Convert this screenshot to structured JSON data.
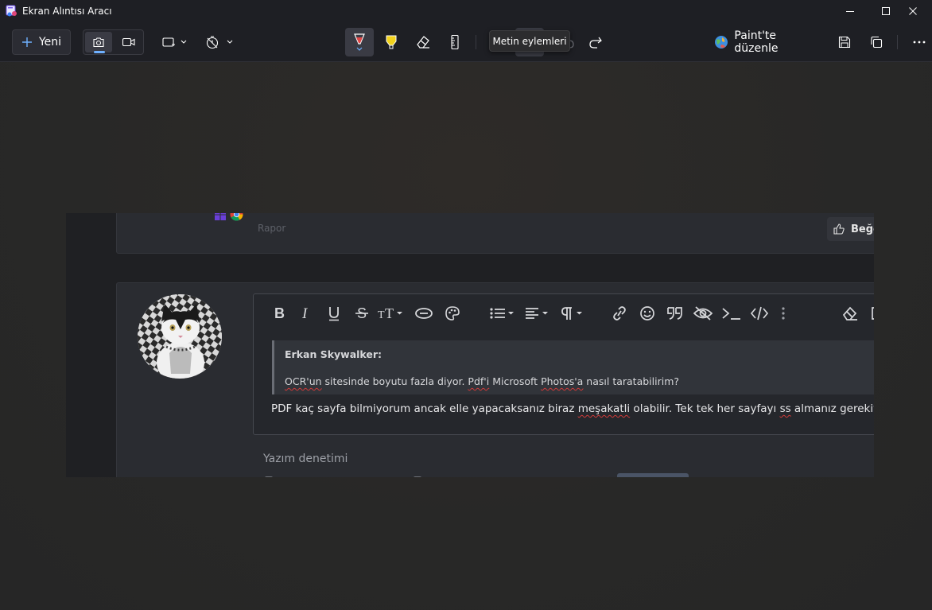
{
  "window": {
    "title": "Ekran Alıntısı Aracı"
  },
  "toolbar": {
    "new_label": "Yeni",
    "paint_label": "Paint'te düzenle",
    "tooltip": "Metin eylemleri"
  },
  "capture": {
    "post1": {
      "report_label": "Rapor",
      "like_label": "Beğe"
    },
    "editor": {
      "quote_author": "Erkan Skywalker:",
      "quote_text_parts": [
        "OCR'un",
        " sitesinde boyutu fazla diyor. ",
        "Pdf'i",
        " Microsoft ",
        "Photos'a",
        " nasıl taratabilirim?"
      ],
      "body_parts": [
        "PDF kaç sayfa bilmiyorum ancak elle yapacaksanız biraz ",
        "meşakatli",
        " olabilir. Tek tek her sayfayı ",
        "ss",
        " almanız gerekiyor önce, d"
      ]
    },
    "spellcheck_label": "Yazım denetimi"
  },
  "colors": {
    "accent": "#6fb1ff",
    "titlebar_bg": "#1e1f24",
    "canvas_bg": "#282827",
    "highlighter_yellow": "#f2d21c",
    "pen_red": "#e04848"
  },
  "icons": {
    "titlebar": [
      "snipping-tool-app-icon",
      "minimize-icon",
      "maximize-icon",
      "close-icon"
    ],
    "toolbar": [
      "plus-icon",
      "camera-icon",
      "video-icon",
      "rectangle-snip-icon",
      "timer-icon",
      "ballpoint-pen-icon",
      "highlighter-icon",
      "eraser-icon",
      "ruler-icon",
      "crop-icon",
      "text-actions-icon",
      "undo-icon",
      "redo-icon",
      "paint-globe-icon",
      "save-icon",
      "copy-icon",
      "more-icon"
    ],
    "editor": [
      "bold-icon",
      "italic-icon",
      "underline-icon",
      "strikethrough-icon",
      "text-size-icon",
      "link-style-icon",
      "palette-icon",
      "list-icon",
      "align-icon",
      "paragraph-icon",
      "link-icon",
      "emoji-icon",
      "quote-icon",
      "spoiler-icon",
      "inline-code-icon",
      "code-icon",
      "more-options-icon",
      "clear-format-icon"
    ]
  }
}
